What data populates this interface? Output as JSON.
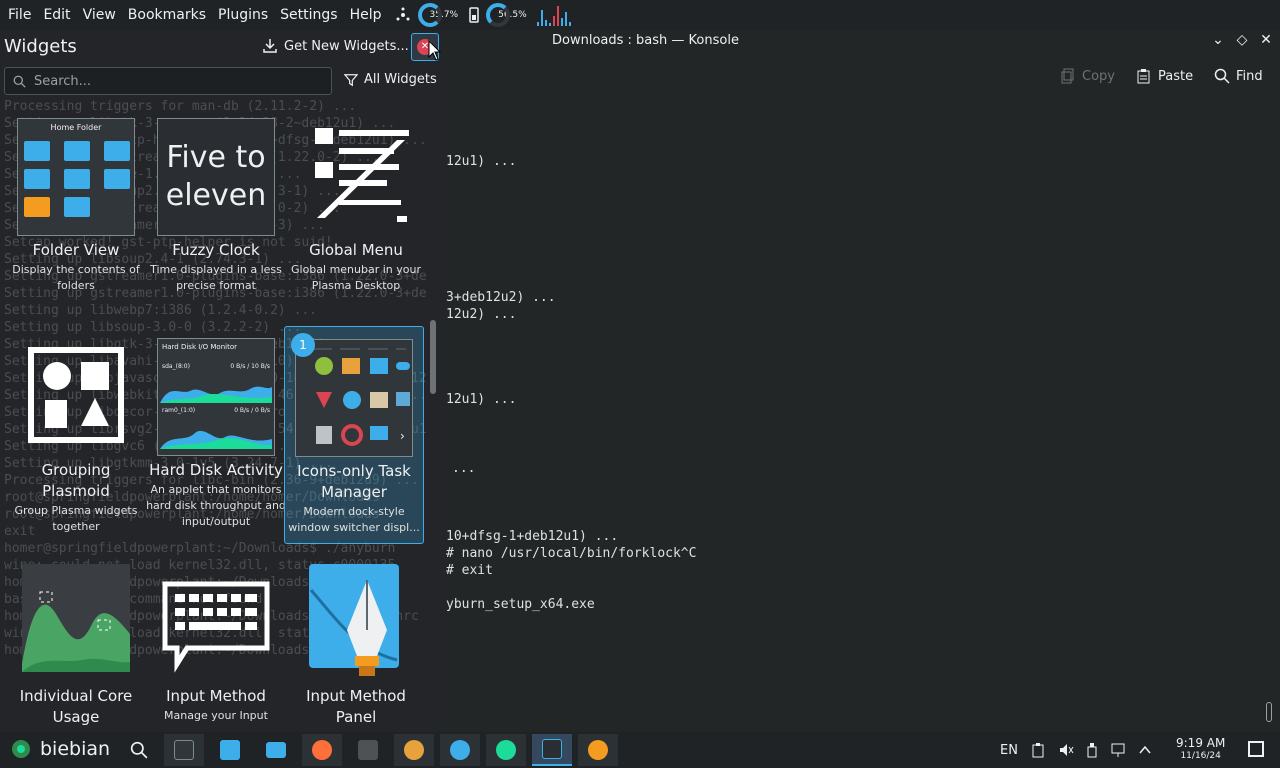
{
  "menubar": {
    "items": [
      "File",
      "Edit",
      "View",
      "Bookmarks",
      "Plugins",
      "Settings",
      "Help"
    ],
    "cpu_percent": "35.7%",
    "mem_percent": "56.5%"
  },
  "konsole": {
    "title": "Downloads : bash — Konsole",
    "toolbar": {
      "copy": "Copy",
      "paste": "Paste",
      "find": "Find"
    },
    "lines": [
      "12u1) ...",
      "3+deb12u2) ...",
      "12u2) ...",
      "12u1) ...",
      "...",
      "10+dfsg-1+deb12u1) ...",
      "# nano /usr/local/bin/forklock^C",
      "# exit",
      "yburn_setup_x64.exe"
    ]
  },
  "widgets": {
    "title": "Widgets",
    "get_new": "Get New Widgets...",
    "search_placeholder": "Search...",
    "filter": "All Widgets",
    "background_lines": [
      "Processing triggers for man-db (2.11.2-2) ...",
      "Setting up libgtk-3-common (3.24.38-2~deb12u1) ...",
      "Setting up gst-ptp-helper (2.42.10+dfsg-1+deb12u1) ...",
      "Setting up libgstreamer1.0-0:i386 (1.22.0-2) ...",
      "Setting up libwpe-1.0-1 (1.14.0-1) ...",
      "Setting up libsoup2.4-common (2.74.3-1) ...",
      "Setting up libgstreamer1.0-0 (1.22.0-2) ...",
      "Setting up gstreamer1.0-gl (1.22.0-3) ...",
      "Setcap worked! gst-ptp-helper is not suid!",
      "Setting up libsoup2.4-1 (2.74.3-1) ...",
      "Setting up gstreamer1.0-plugins-base:i386 (1.22.0-3+deb12u2) ...",
      "Setting up gstreamer1.0-plugins-base:i386 (1.22.0-3+deb12u2) ...",
      "Setting up libwebp7:i386 (1.2.4-0.2) ...",
      "Setting up libsoup-3.0-0 (3.2.2-2) ...",
      "Setting up libgtk-3-0 (3.24.38-2~deb12u1) ...",
      "Setting up libavahi-gobject0 (0.8-10) ...",
      "Setting up libjavascriptcoregtk-4.0-18 (2.46.3-1~deb12u1) ...",
      "Setting up libwebkit2gtk-4.0-37 (2.46.3-1~deb12u1) ...",
      "Setting up libdecor-0-plugin-1-cairo (0.1.1-2) ...",
      "Setting up librsvg2-common:i386 (2.54.7+dfsg-1~deb12u1) ...",
      "Setting up libgvc6 (2.42.2-7+b3) ...",
      "Setting up libgtkmm-3.0-1v5 (3.24.7-1) ...",
      "Processing triggers for libc-bin (2.36-9+deb12u9) ...",
      "root@springfieldpowerplant:/home/homer/Downloads",
      "root@springfieldpowerplant:/home/homer/Downloads",
      "exit",
      "homer@springfieldpowerplant:~/Downloads$ ./anyburn",
      "wine: could not load kernel32.dll, status c0000135",
      "homer@springfieldpowerplant:~/Downloads$ ",
      "bash: forklock: command not found",
      "homer@springfieldpowerplant:~/Downloads$ nano .bashrc",
      "wine: could not load kernel32.dll, status c0000135",
      "homer@springfieldpowerplant:~/Downloads$ "
    ],
    "items": [
      {
        "name": "Folder View",
        "desc": "Display the contents of folders",
        "thumb_label": "Home Folder"
      },
      {
        "name": "Fuzzy Clock",
        "desc": "Time displayed in a less precise format",
        "thumb_text": "Five to eleven"
      },
      {
        "name": "Global Menu",
        "desc": "Global menubar in your Plasma Desktop"
      },
      {
        "name": "Grouping Plasmoid",
        "desc": "Group Plasma widgets together"
      },
      {
        "name": "Hard Disk Activity",
        "desc": "An applet that monitors hard disk throughput and input/output",
        "thumb_label": "Hard Disk I/O Monitor",
        "disk1": "sda_(8:0)",
        "disk1_rate": "0 B/s / 10 B/s",
        "disk2": "ram0_(1:0)",
        "disk2_rate": "0 B/s / 0 B/s"
      },
      {
        "name": "Icons-only Task Manager",
        "desc": "Modern dock-style window switcher displ...",
        "badge": "1"
      },
      {
        "name": "Individual Core Usage",
        "desc": ""
      },
      {
        "name": "Input Method",
        "desc": "Manage your Input"
      },
      {
        "name": "Input Method Panel",
        "desc": ""
      }
    ]
  },
  "taskbar": {
    "start_label": "biebian",
    "lang": "EN",
    "time": "9:19 AM",
    "date": "11/16/24"
  },
  "colors": {
    "accent": "#3daee9",
    "close": "#da4453",
    "folder_orange": "#f39c1f"
  }
}
